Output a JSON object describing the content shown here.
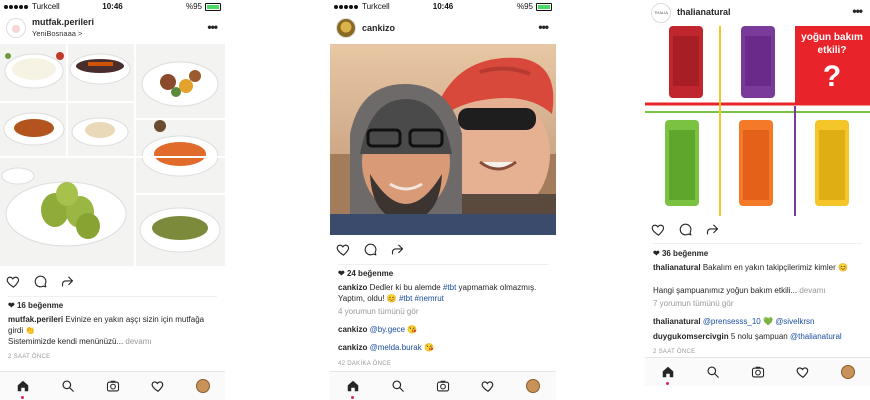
{
  "colors": {
    "accent": "#1a4fa0",
    "like_red": "#e0245e",
    "grey": "#999999"
  },
  "status": {
    "carrier": "Turkcell",
    "time": "10:46",
    "battery": "%95"
  },
  "posts": [
    {
      "username": "mutfak.perileri",
      "location": "YeniBosnaaa",
      "location_chevron": ">",
      "more": "•••",
      "likes": "16 beğenme",
      "caption_user": "mutfak.perileri",
      "caption_text": "Evinize en yakın aşçı sizin için mutfağa girdi",
      "caption_line2": "Sistemimizde kendi menünüzü...",
      "caption_more": "devamı",
      "time": "2 SAAT ÖNCE"
    },
    {
      "username": "cankizo",
      "more": "•••",
      "likes": "24 beğenme",
      "caption_user": "cankizo",
      "caption_text": "Dedler ki bu alemde",
      "caption_tag1": "#tbt",
      "caption_text2": "yapmamak olmazmış. Yaptım, oldu! 😊",
      "caption_tag2": "#tbt",
      "caption_tag3": "#nemrut",
      "comments_link": "4 yorumun tümünü gör",
      "comments": [
        {
          "user": "cankizo",
          "mention": "@by.gece",
          "emoji": "😘"
        },
        {
          "user": "cankizo",
          "mention": "@melda.burak",
          "emoji": "😘"
        }
      ],
      "time": "42 DAKİKA ÖNCE"
    },
    {
      "username": "thalianatural",
      "more": "•••",
      "overlay_text": "yoğun bakım etkili?",
      "overlay_question": "?",
      "likes": "36 beğenme",
      "caption_user": "thalianatural",
      "caption_text": "Bakalım en yakın takipçilerimiz kimler 😊",
      "caption_line2": "Hangi şampuanımız yoğun bakım etkili...",
      "caption_more": "devamı",
      "comments_link": "7 yorumun tümünü gör",
      "comments": [
        {
          "user": "thalianatural",
          "mention": "@prensesss_10",
          "emoji": "💚",
          "mention2": "@sivelkrsn"
        },
        {
          "user": "duygukomsercivgin",
          "text": "5 nolu şampuan",
          "mention": "@thalianatural"
        }
      ],
      "time": "2 SAAT ÖNCE"
    }
  ],
  "tabbar": {
    "icons": [
      "home-icon",
      "search-icon",
      "camera-icon",
      "heart-icon",
      "profile-avatar"
    ]
  }
}
